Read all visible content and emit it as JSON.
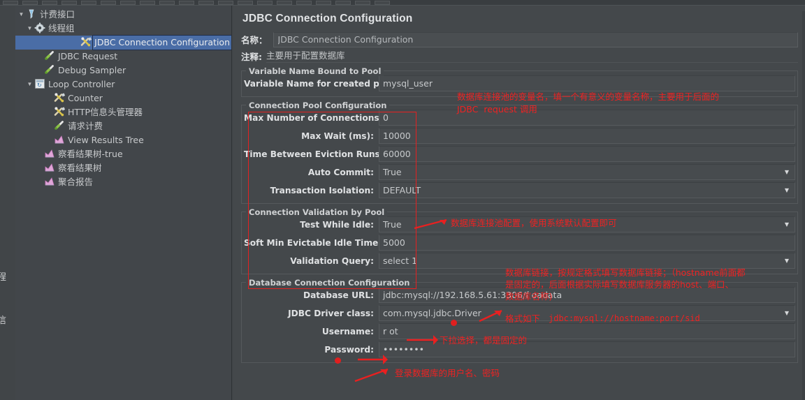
{
  "window": {
    "bg": "#44484b",
    "accent_blue": "#4a6da6",
    "anno_red": "#ef2222"
  },
  "toolbar": {
    "buttons": [
      "new",
      "open",
      "save",
      "cut",
      "copy",
      "paste",
      "expand",
      "collapse",
      "toggle",
      "start",
      "stop",
      "shutdown",
      "clear",
      "clear-all",
      "search",
      "reset",
      "help",
      "more",
      "extra",
      "last"
    ]
  },
  "left_strip": {
    "glyph_top": "程",
    "glyph_bottom": "信"
  },
  "tree": {
    "items": [
      {
        "label": "计费接口",
        "icon": "funnel-icon",
        "indent": 0,
        "twisty": "▼",
        "selected": false
      },
      {
        "label": "线程组",
        "icon": "gear-icon",
        "indent": 1,
        "twisty": "▼",
        "selected": false
      },
      {
        "label": "JDBC Connection Configuration",
        "icon": "wrench-icon",
        "indent": 2,
        "twisty": "",
        "selected": true
      },
      {
        "label": "JDBC Request",
        "icon": "pipette-icon",
        "indent": 2,
        "twisty": "",
        "selected": false
      },
      {
        "label": "Debug Sampler",
        "icon": "pipette-icon",
        "indent": 2,
        "twisty": "",
        "selected": false
      },
      {
        "label": "Loop Controller",
        "icon": "loop-icon",
        "indent": 1,
        "twisty": "▼",
        "selected": false
      },
      {
        "label": "Counter",
        "icon": "wrench-icon",
        "indent": 3,
        "twisty": "",
        "selected": false
      },
      {
        "label": "HTTP信息头管理器",
        "icon": "wrench-icon",
        "indent": 3,
        "twisty": "",
        "selected": false
      },
      {
        "label": "请求计费",
        "icon": "pipette-icon",
        "indent": 3,
        "twisty": "",
        "selected": false
      },
      {
        "label": "View Results Tree",
        "icon": "chart-icon",
        "indent": 3,
        "twisty": "",
        "selected": false
      },
      {
        "label": "察看结果树-true",
        "icon": "chart-icon",
        "indent": 2,
        "twisty": "",
        "selected": false
      },
      {
        "label": "察看结果树",
        "icon": "chart-icon",
        "indent": 2,
        "twisty": "",
        "selected": false
      },
      {
        "label": "聚合报告",
        "icon": "chart-icon",
        "indent": 2,
        "twisty": "",
        "selected": false
      }
    ]
  },
  "panel": {
    "title": "JDBC Connection Configuration",
    "name_label": "名称：",
    "name_value": "JDBC Connection Configuration",
    "comment_label": "注释:",
    "comment_value": "主要用于配置数据库",
    "groups": {
      "pool_binding": {
        "title": "Variable Name Bound to Pool",
        "fields": [
          {
            "label": "Variable Name for created pool:",
            "value": "mysql_user",
            "type": "text"
          }
        ]
      },
      "pool_config": {
        "title": "Connection Pool Configuration",
        "fields": [
          {
            "label": "Max Number of Connections:",
            "value": "0",
            "type": "text"
          },
          {
            "label": "Max Wait (ms):",
            "value": "10000",
            "type": "text"
          },
          {
            "label": "Time Between Eviction Runs (ms):",
            "value": "60000",
            "type": "text"
          },
          {
            "label": "Auto Commit:",
            "value": "True",
            "type": "dropdown"
          },
          {
            "label": "Transaction Isolation:",
            "value": "DEFAULT",
            "type": "dropdown"
          }
        ]
      },
      "validation": {
        "title": "Connection Validation by Pool",
        "fields": [
          {
            "label": "Test While Idle:",
            "value": "True",
            "type": "dropdown"
          },
          {
            "label": "Soft Min Evictable Idle Time(ms):",
            "value": "5000",
            "type": "text"
          },
          {
            "label": "Validation Query:",
            "value": "select 1",
            "type": "dropdown"
          }
        ]
      },
      "db_connection": {
        "title": "Database Connection Configuration",
        "fields": [
          {
            "label": "Database URL:",
            "value": "jdbc:mysql://192.168.5.61:3306/f  oadata",
            "type": "text"
          },
          {
            "label": "JDBC Driver class:",
            "value": "com.mysql.jdbc.Driver",
            "type": "dropdown"
          },
          {
            "label": "Username:",
            "value": "r  ot",
            "type": "text"
          },
          {
            "label": "Password:",
            "value": "••••••••",
            "type": "text"
          }
        ]
      }
    }
  },
  "annotations": [
    {
      "id": "anno-varname",
      "lines": [
        "数据库连接池的变量名，填一个有意义的变量名称，主要用于后面的",
        "JDBC  request 调用"
      ]
    },
    {
      "id": "anno-poolconfig",
      "lines": [
        "数据库连接池配置，使用系统默认配置即可"
      ]
    },
    {
      "id": "anno-dburl-block",
      "lines": [
        "数据库链接，按规定格式填写数据库链接；（hostname前面都",
        "是固定的，后面根据实际填写数据库服务器的host、端口、",
        "数据库名称)"
      ]
    },
    {
      "id": "anno-dburl-format",
      "prefix": "格式如下 ",
      "mono": "jdbc:mysql://hostname:port/sid"
    },
    {
      "id": "anno-driver",
      "lines": [
        "下拉选择，都是固定的"
      ]
    },
    {
      "id": "anno-credentials",
      "lines": [
        "登录数据库的用户名、密码"
      ]
    }
  ]
}
